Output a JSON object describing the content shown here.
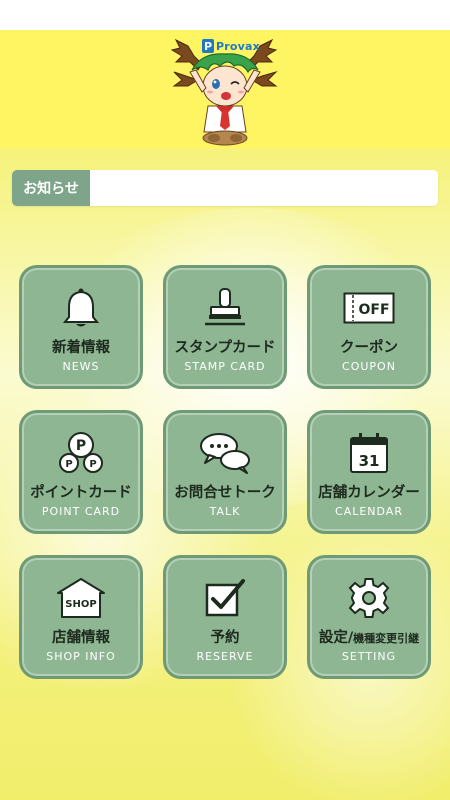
{
  "header": {
    "logo_mark": "P",
    "logo_text": "Provax"
  },
  "notice": {
    "label": "お知らせ",
    "content": ""
  },
  "menu": [
    {
      "jp": "新着情報",
      "en": "NEWS",
      "icon": "bell-icon"
    },
    {
      "jp": "スタンプカード",
      "en": "STAMP CARD",
      "icon": "stamp-icon"
    },
    {
      "jp": "クーポン",
      "en": "COUPON",
      "icon": "coupon-icon",
      "icon_text": "OFF"
    },
    {
      "jp": "ポイントカード",
      "en": "POINT CARD",
      "icon": "point-coins-icon",
      "icon_text": "P"
    },
    {
      "jp": "お問合せトーク",
      "en": "TALK",
      "icon": "chat-bubbles-icon"
    },
    {
      "jp": "店舗カレンダー",
      "en": "CALENDAR",
      "icon": "calendar-icon",
      "icon_text": "31"
    },
    {
      "jp": "店舗情報",
      "en": "SHOP INFO",
      "icon": "shop-icon",
      "icon_text": "SHOP"
    },
    {
      "jp": "予約",
      "en": "RESERVE",
      "icon": "checkbox-icon"
    },
    {
      "jp_main": "設定/",
      "jp_sub": "機種変更引継",
      "en": "SETTING",
      "icon": "gear-icon"
    }
  ],
  "colors": {
    "header_bg": "#fff563",
    "tile_bg": "#8fb692",
    "tile_border": "#6e9a75",
    "notice_label_bg": "#7ea58a",
    "logo_blue": "#1f7ac2"
  }
}
